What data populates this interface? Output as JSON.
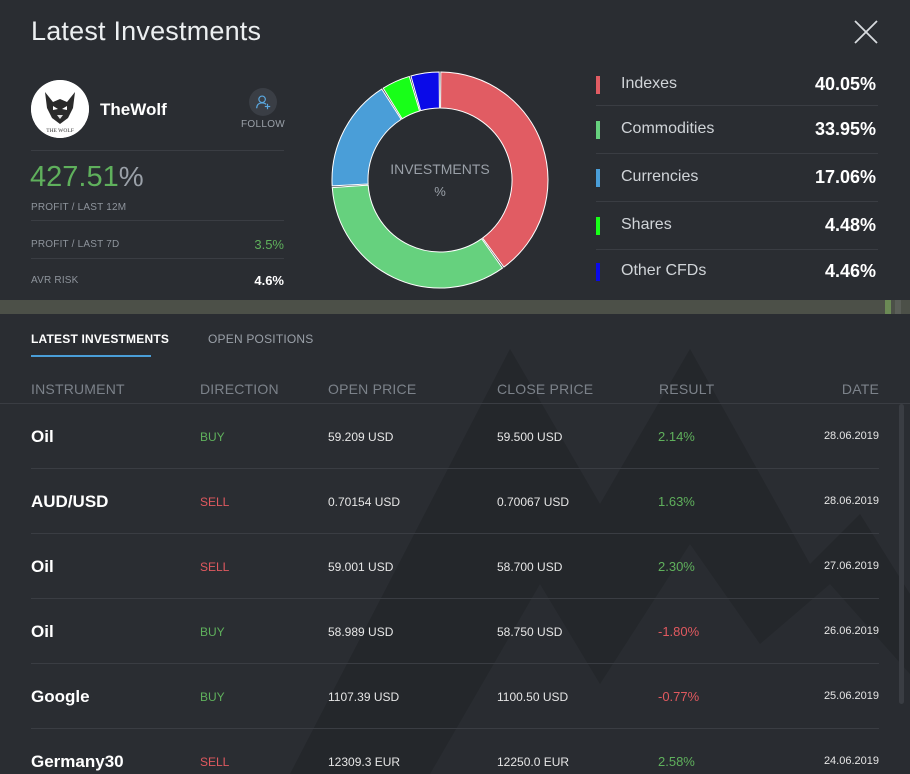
{
  "header": {
    "title": "Latest Investments"
  },
  "profile": {
    "name": "TheWolf",
    "avatar_text": "THE WOLF",
    "follow_label": "FOLLOW",
    "profit_value": "427.51",
    "profit_unit": "%",
    "profit_label": "PROFIT / LAST 12M",
    "stats": [
      {
        "label": "PROFIT / LAST 7D",
        "value": "3.5%"
      },
      {
        "label": "AVR RISK",
        "value": "4.6%"
      }
    ]
  },
  "donut": {
    "label": "INVESTMENTS",
    "unit": "%"
  },
  "chart_data": {
    "type": "pie",
    "title": "INVESTMENTS",
    "categories": [
      "Indexes",
      "Commodities",
      "Currencies",
      "Shares",
      "Other CFDs"
    ],
    "values": [
      40.05,
      33.95,
      17.06,
      4.48,
      4.46
    ],
    "colors": [
      "#e15c63",
      "#66d17e",
      "#4a9ed8",
      "#18ff18",
      "#0a0ae8"
    ]
  },
  "legend": [
    {
      "name": "Indexes",
      "value": "40.05%",
      "color": "#e15c63"
    },
    {
      "name": "Commodities",
      "value": "33.95%",
      "color": "#66d17e"
    },
    {
      "name": "Currencies",
      "value": "17.06%",
      "color": "#4a9ed8"
    },
    {
      "name": "Shares",
      "value": "4.48%",
      "color": "#18ff18"
    },
    {
      "name": "Other CFDs",
      "value": "4.46%",
      "color": "#0a0ae8"
    }
  ],
  "tabs": [
    {
      "label": "LATEST INVESTMENTS",
      "active": true
    },
    {
      "label": "OPEN POSITIONS",
      "active": false
    }
  ],
  "table": {
    "columns": [
      "INSTRUMENT",
      "DIRECTION",
      "OPEN PRICE",
      "CLOSE PRICE",
      "RESULT",
      "DATE"
    ],
    "rows": [
      {
        "instrument": "Oil",
        "direction": "BUY",
        "open": "59.209 USD",
        "close": "59.500 USD",
        "result": "2.14%",
        "date": "28.06.2019"
      },
      {
        "instrument": "AUD/USD",
        "direction": "SELL",
        "open": "0.70154 USD",
        "close": "0.70067 USD",
        "result": "1.63%",
        "date": "28.06.2019"
      },
      {
        "instrument": "Oil",
        "direction": "SELL",
        "open": "59.001 USD",
        "close": "58.700 USD",
        "result": "2.30%",
        "date": "27.06.2019"
      },
      {
        "instrument": "Oil",
        "direction": "BUY",
        "open": "58.989 USD",
        "close": "58.750 USD",
        "result": "-1.80%",
        "date": "26.06.2019"
      },
      {
        "instrument": "Google",
        "direction": "BUY",
        "open": "1107.39 USD",
        "close": "1100.50 USD",
        "result": "-0.77%",
        "date": "25.06.2019"
      },
      {
        "instrument": "Germany30",
        "direction": "SELL",
        "open": "12309.3 EUR",
        "close": "12250.0 EUR",
        "result": "2.58%",
        "date": "24.06.2019"
      }
    ]
  }
}
